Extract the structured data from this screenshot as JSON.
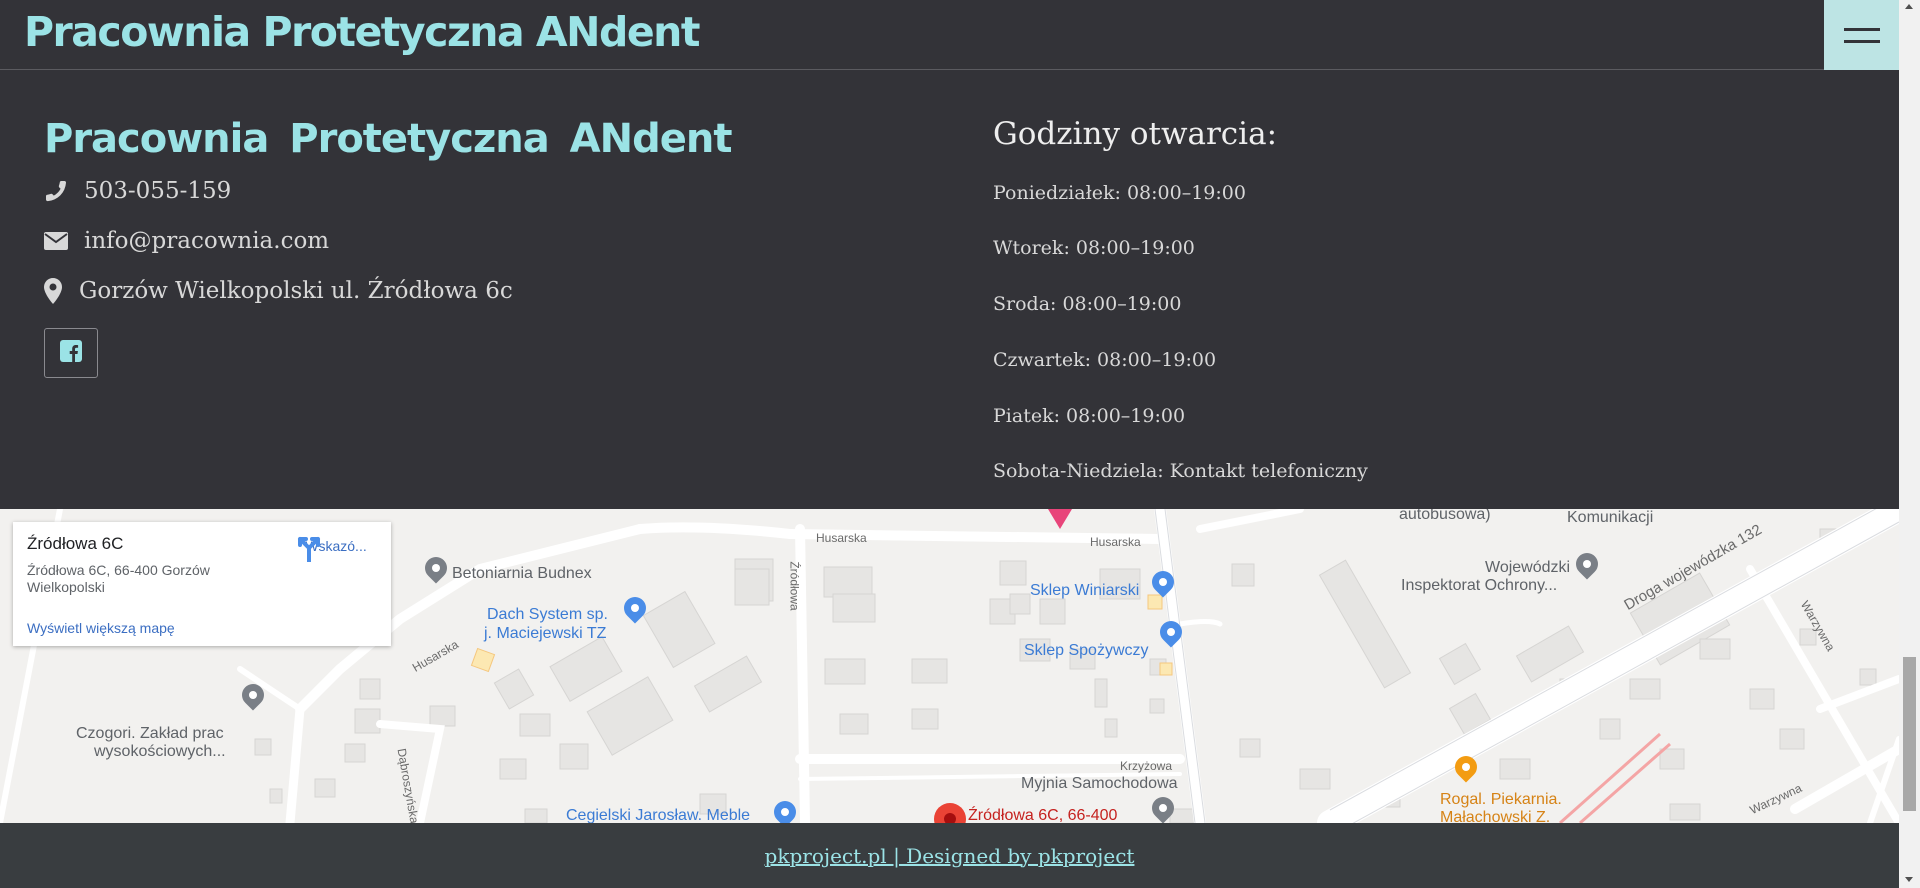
{
  "header": {
    "brand": "Pracownia Protetyczna ANdent",
    "menu_icon": "hamburger-icon"
  },
  "contact": {
    "title": "Pracownia Protetyczna ANdent",
    "phone": "503-055-159",
    "email": "info@pracownia.com",
    "address": "Gorzów Wielkopolski ul. Źródłowa 6c",
    "icons": [
      "phone-icon",
      "envelope-icon",
      "map-marker-icon",
      "facebook-icon"
    ]
  },
  "hours": {
    "title": "Godziny otwarcia:",
    "lines": [
      "Poniedziałek: 08:00–19:00",
      "Wtorek: 08:00–19:00",
      "Sroda: 08:00–19:00",
      "Czwartek: 08:00–19:00",
      "Piatek: 08:00–19:00",
      "Sobota-Niedziela: Kontakt telefoniczny"
    ]
  },
  "map": {
    "card": {
      "title": "Źródłowa 6C",
      "address": "Źródłowa 6C, 66-400 Gorzów Wielkopolski",
      "directions": "Wskazó...",
      "larger_map": "Wyświetl większą mapę"
    },
    "labels": {
      "betoniarnia": "Betoniarnia Budnex",
      "dach1": "Dach System sp.",
      "dach2": "j. Maciejewski TZ",
      "winiarski": "Sklep Winiarski",
      "spozywczy": "Sklep Spożywczy",
      "czogori1": "Czogori. Zakład prac",
      "czogori2": "wysokościowych...",
      "myjnia": "Myjnia Samochodowa",
      "cegielski": "Cegielski Jarosław. Meble",
      "zrodlowa": "Źródłowa 6C, 66-400",
      "autobusowa": "autobusowa)",
      "komunikacji": "Komunikacji",
      "wojewodzki1": "Wojewódzki",
      "wojewodzki2": "Inspektorat Ochrony...",
      "rogal1": "Rogal. Piekarnia.",
      "rogal2": "Małachowski Z.",
      "husarska1": "Husarska",
      "husarska2": "Husarska",
      "husarska3": "Husarska",
      "zrodlowa_st": "Źródłowa",
      "dabroszynska": "Dąbroszyńska",
      "krzyzowa": "Krzyżowa",
      "droga": "Droga wojewódzka 132",
      "warzywna1": "Warzywna",
      "warzywna2": "Warzywna"
    }
  },
  "footer": {
    "link": "pkproject.pl | Designed by pkproject"
  },
  "colors": {
    "background": "#333338",
    "accent": "#9be3e6",
    "menu_button": "#bde4e4",
    "footer_bar": "#393d40"
  }
}
